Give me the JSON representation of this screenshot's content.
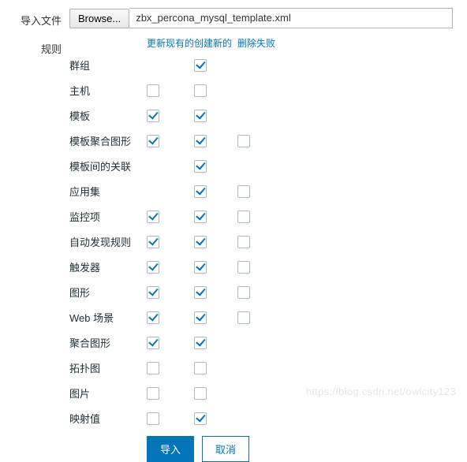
{
  "file": {
    "label": "导入文件",
    "browse": "Browse...",
    "filename": "zbx_percona_mysql_template.xml"
  },
  "rules": {
    "label": "规则",
    "headers": {
      "update": "更新现有的",
      "create": "创建新的",
      "delete": "删除失败"
    },
    "items": [
      {
        "name": "群组",
        "update": null,
        "create": true,
        "delete": null
      },
      {
        "name": "主机",
        "update": false,
        "create": false,
        "delete": null
      },
      {
        "name": "模板",
        "update": true,
        "create": true,
        "delete": null
      },
      {
        "name": "模板聚合图形",
        "update": true,
        "create": true,
        "delete": false
      },
      {
        "name": "模板间的关联",
        "update": null,
        "create": true,
        "delete": null
      },
      {
        "name": "应用集",
        "update": null,
        "create": true,
        "delete": false
      },
      {
        "name": "监控项",
        "update": true,
        "create": true,
        "delete": false
      },
      {
        "name": "自动发现规则",
        "update": true,
        "create": true,
        "delete": false
      },
      {
        "name": "触发器",
        "update": true,
        "create": true,
        "delete": false
      },
      {
        "name": "图形",
        "update": true,
        "create": true,
        "delete": false
      },
      {
        "name": "Web 场景",
        "update": true,
        "create": true,
        "delete": false
      },
      {
        "name": "聚合图形",
        "update": true,
        "create": true,
        "delete": null
      },
      {
        "name": "拓扑图",
        "update": false,
        "create": false,
        "delete": null
      },
      {
        "name": "图片",
        "update": false,
        "create": false,
        "delete": null
      },
      {
        "name": "映射值",
        "update": false,
        "create": true,
        "delete": null
      }
    ]
  },
  "buttons": {
    "import": "导入",
    "cancel": "取消"
  },
  "watermark": "https://blog.csdn.net/owlcity123"
}
